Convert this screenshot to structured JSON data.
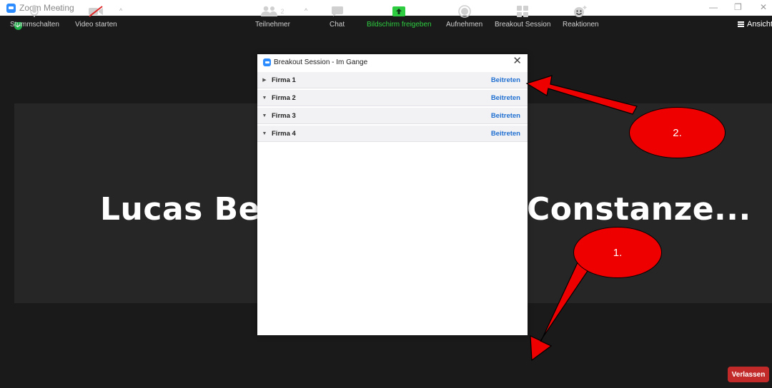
{
  "window": {
    "title": "Zoom Meeting"
  },
  "view_button": "Ansicht",
  "participant_names": {
    "left": "Lucas Bey",
    "right": "Constanze..."
  },
  "dialog": {
    "title": "Breakout Session - Im Gange",
    "rooms": [
      {
        "name": "Firma 1",
        "action": "Beitreten",
        "expanded": false
      },
      {
        "name": "Firma 2",
        "action": "Beitreten",
        "expanded": true
      },
      {
        "name": "Firma 3",
        "action": "Beitreten",
        "expanded": true
      },
      {
        "name": "Firma 4",
        "action": "Beitreten",
        "expanded": true
      }
    ]
  },
  "toolbar": {
    "mute": "Stummschalten",
    "video": "Video starten",
    "participants": "Teilnehmer",
    "participants_count": "2",
    "chat": "Chat",
    "share": "Bildschirm freigeben",
    "record": "Aufnehmen",
    "breakout": "Breakout Session",
    "reactions": "Reaktionen",
    "leave": "Verlassen"
  },
  "annotations": {
    "callout_1": "1.",
    "callout_2": "2."
  },
  "colors": {
    "share_green": "#2ecc40",
    "leave_red": "#c22a2a",
    "link_blue": "#1f6fd1",
    "annotation_red": "#ee0000"
  }
}
